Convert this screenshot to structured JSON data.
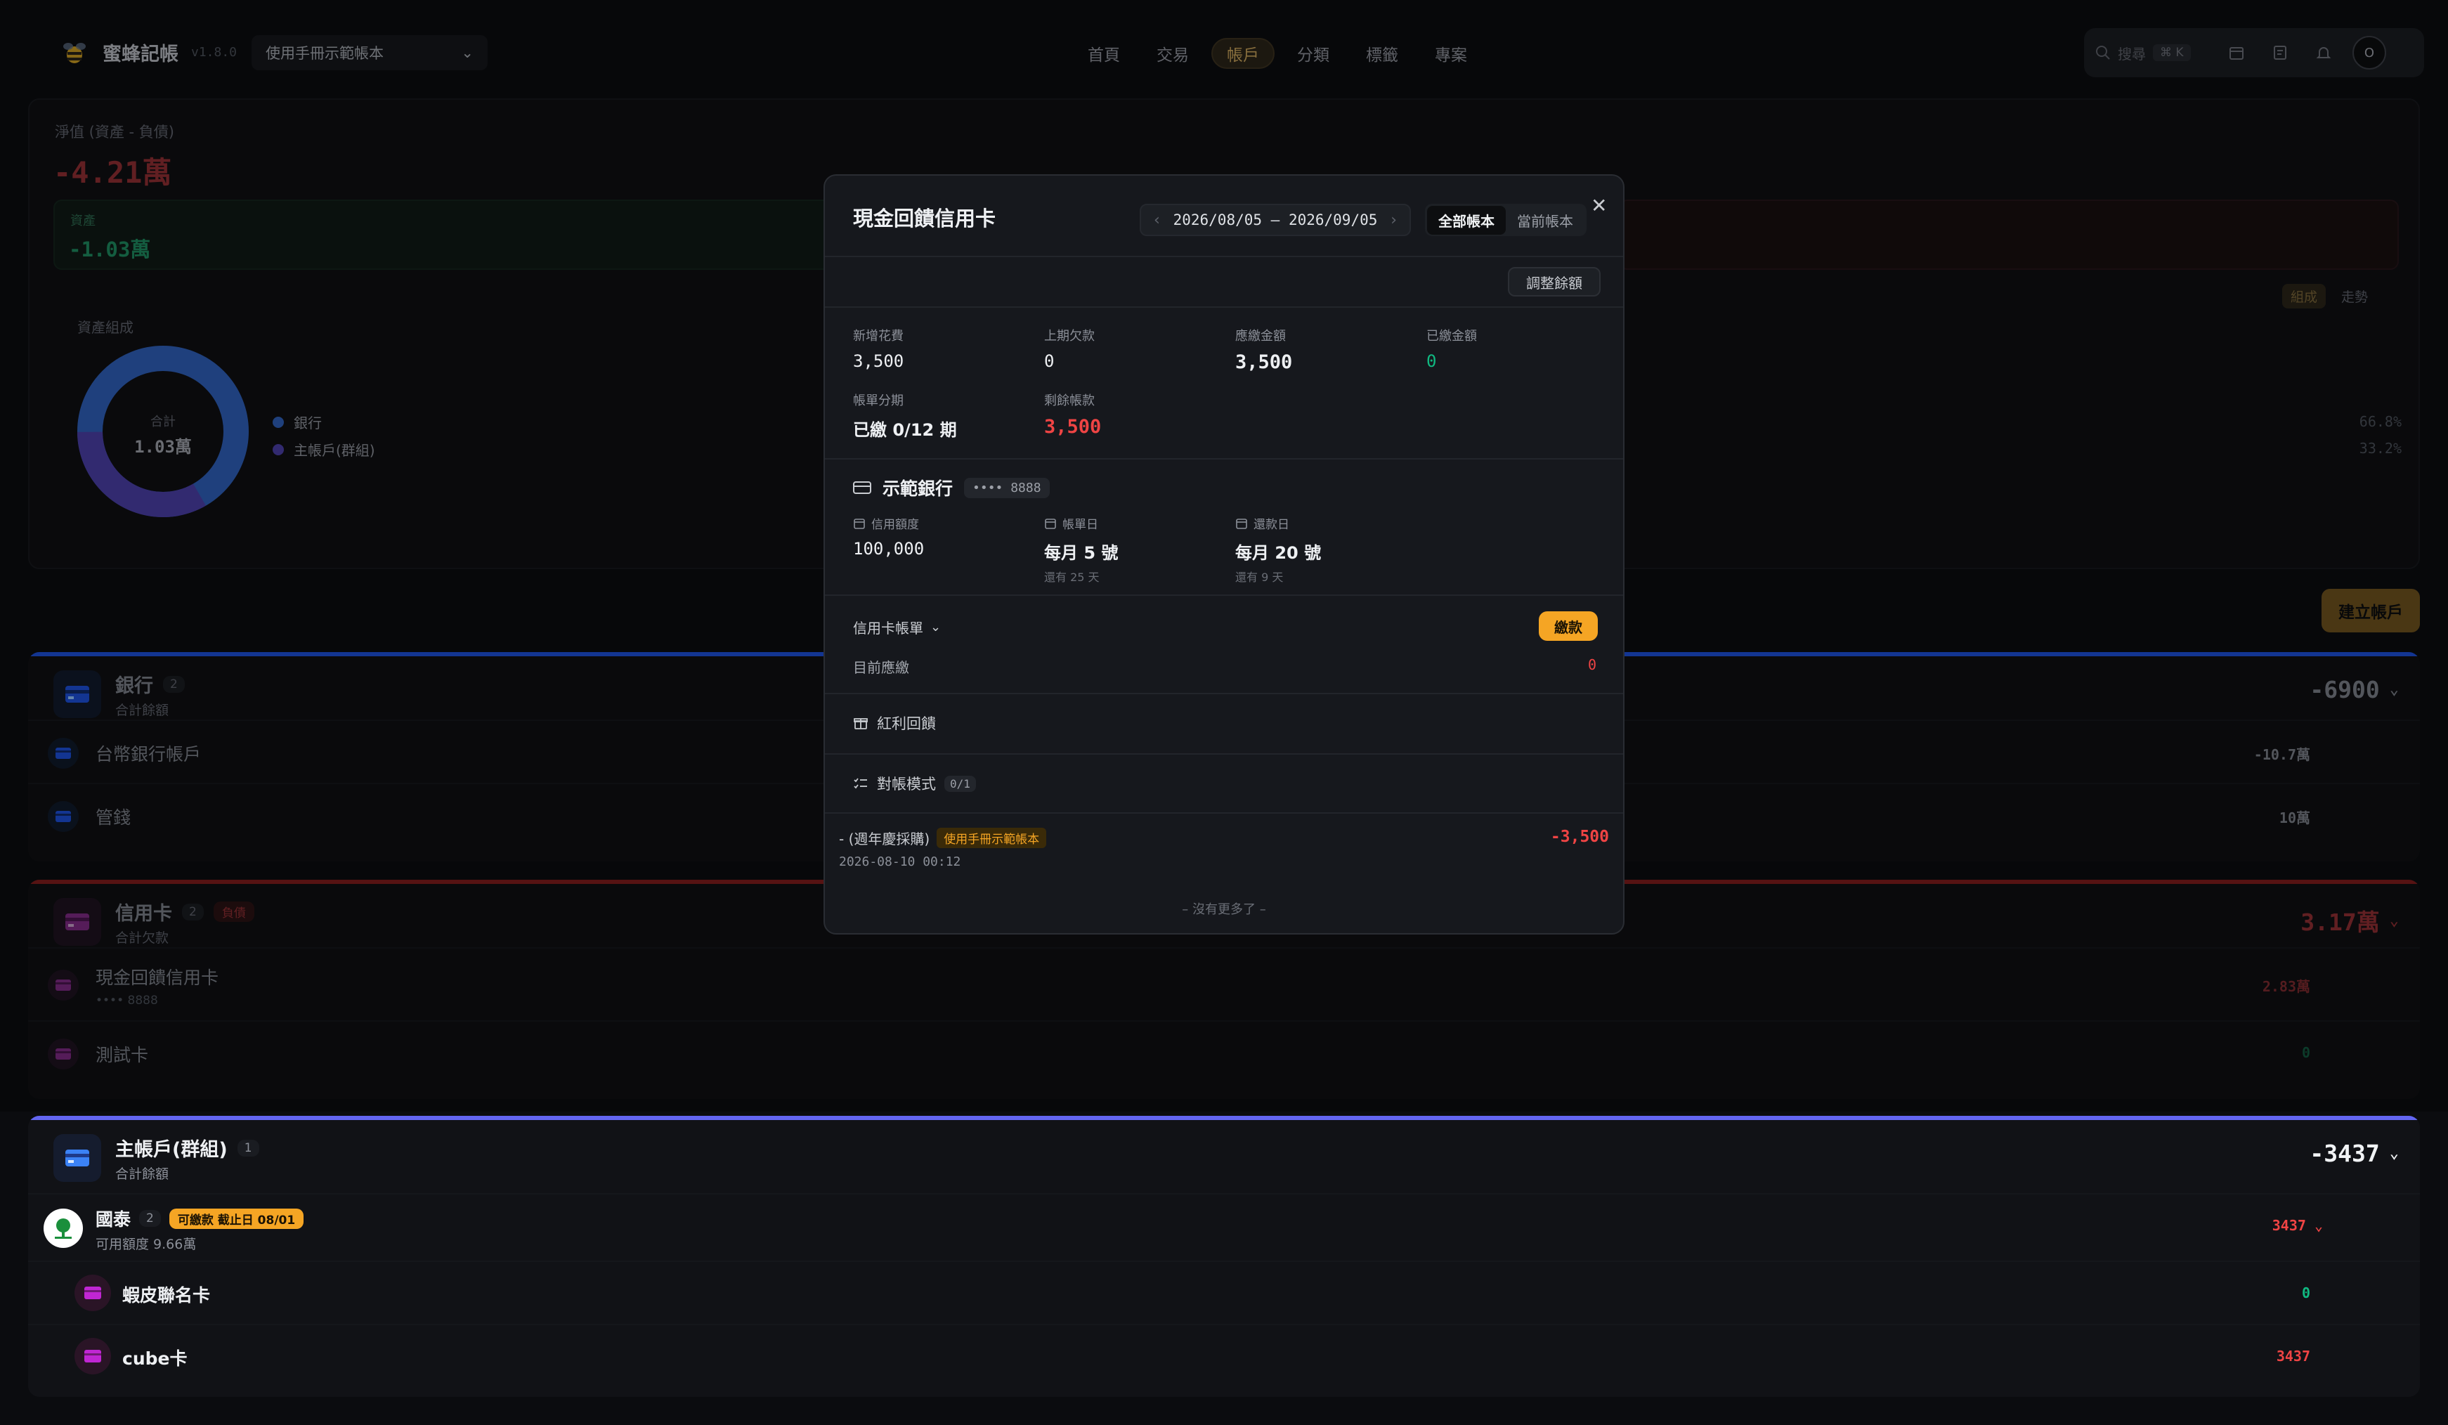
{
  "header": {
    "app_name": "蜜蜂記帳",
    "version": "v1.8.0",
    "book_select": "使用手冊示範帳本",
    "nav": [
      "首頁",
      "交易",
      "帳戶",
      "分類",
      "標籤",
      "專案"
    ],
    "active_nav": "帳戶",
    "search_placeholder": "搜尋",
    "search_shortcut": "⌘ K",
    "avatar_initial": "O"
  },
  "summary": {
    "networth_label": "淨值 (資產 - 負債)",
    "networth_value": "-4.21萬",
    "asset_label": "資產",
    "asset_value": "-1.03萬",
    "composition_label": "資產組成",
    "donut_center_label": "合計",
    "donut_center_value": "1.03萬",
    "legend": [
      {
        "name": "銀行",
        "color": "#2f5fb8",
        "pct": "66.8%"
      },
      {
        "name": "主帳戶(群組)",
        "color": "#4b3fa6",
        "pct": "33.2%"
      }
    ],
    "view_toggle": [
      "組成",
      "走勢"
    ]
  },
  "create_account_button": "建立帳戶",
  "groups": {
    "bank": {
      "title": "銀行",
      "count": "2",
      "subtitle": "合計餘額",
      "total": "-6900",
      "color": "#2563eb",
      "rows": [
        {
          "name": "台幣銀行帳戶",
          "value": "-10.7萬"
        },
        {
          "name": "管錢",
          "value": "10萬"
        }
      ]
    },
    "credit": {
      "title": "信用卡",
      "count": "2",
      "tag": "負債",
      "subtitle": "合計欠款",
      "total": "3.17萬",
      "color": "#dc2626",
      "rows": [
        {
          "name": "現金回饋信用卡",
          "sub": "•••• 8888",
          "value": "2.83萬"
        },
        {
          "name": "測試卡",
          "value": "0"
        }
      ]
    },
    "main": {
      "title": "主帳戶(群組)",
      "count": "1",
      "subtitle": "合計餘額",
      "total": "-3437",
      "color": "#6366f1",
      "parent": {
        "name": "國泰",
        "count": "2",
        "tag": "可繳款 截止日 08/01",
        "sub": "可用額度 9.66萬",
        "value": "3437"
      },
      "rows": [
        {
          "name": "蝦皮聯名卡",
          "value": "0"
        },
        {
          "name": "cube卡",
          "value": "3437"
        }
      ]
    }
  },
  "modal": {
    "title": "現金回饋信用卡",
    "date_range": "2026/08/05 – 2026/09/05",
    "scope_toggle": [
      "全部帳本",
      "當前帳本"
    ],
    "adjust_button": "調整餘額",
    "stats": {
      "new_spend_label": "新增花費",
      "new_spend": "3,500",
      "prev_due_label": "上期欠款",
      "prev_due": "0",
      "amount_due_label": "應繳金額",
      "amount_due": "3,500",
      "paid_label": "已繳金額",
      "paid": "0",
      "installment_label": "帳單分期",
      "installment": "已繳 0/12 期",
      "remaining_label": "剩餘帳款",
      "remaining": "3,500"
    },
    "bank": {
      "name": "示範銀行",
      "card_last4": "•••• 8888",
      "credit_limit_label": "信用額度",
      "credit_limit": "100,000",
      "statement_day_label": "帳單日",
      "statement_day": "每月 5 號",
      "statement_remaining": "還有 25 天",
      "payment_day_label": "還款日",
      "payment_day": "每月 20 號",
      "payment_remaining": "還有 9 天"
    },
    "bills_label": "信用卡帳單",
    "pay_button": "繳款",
    "current_due_label": "目前應繳",
    "current_due": "0",
    "rewards_label": "紅利回饋",
    "reconcile_label": "對帳模式",
    "reconcile_count": "0/1",
    "transaction": {
      "desc": "- (週年慶採購)",
      "book_tag": "使用手冊示範帳本",
      "datetime": "2026-08-10 00:12",
      "amount": "-3,500"
    },
    "no_more": "– 沒有更多了 –"
  }
}
